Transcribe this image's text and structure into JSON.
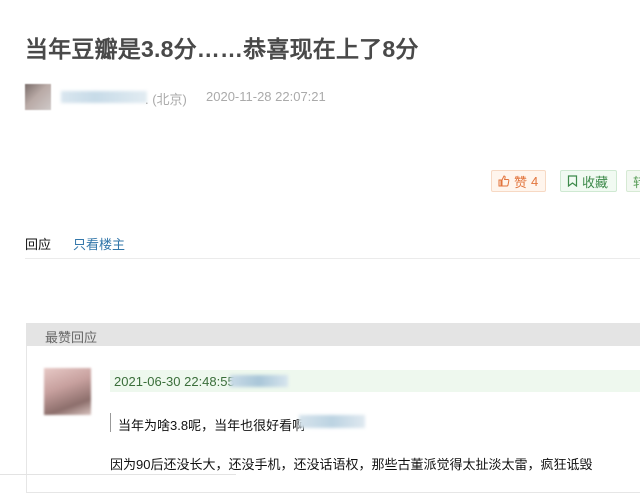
{
  "post": {
    "title": "当年豆瓣是3.8分……恭喜现在上了8分",
    "author_tail": ". (北京)",
    "time": "2020-11-28 22:07:21"
  },
  "actions": {
    "like_label": "赞",
    "like_count": "4",
    "favorite_label": "收藏",
    "share_label": "转"
  },
  "tabs": {
    "reply": "回应",
    "only_op": "只看楼主"
  },
  "best_replies": {
    "header": "最赞回应",
    "comment": {
      "time": "2021-06-30 22:48:55",
      "quote": "当年为啥3.8呢，当年也很好看啊",
      "text": "因为90后还没长大，还没手机，还没话语权，那些古董派觉得太扯淡太雷，疯狂诋毁"
    }
  },
  "colors": {
    "title": "#494949",
    "meta": "#aaaaaa",
    "link": "#3377aa",
    "like": "#e2743c",
    "favorite": "#3e8a4b"
  },
  "icons": {
    "like": "thumbs-up-icon",
    "favorite": "bookmark-icon"
  }
}
